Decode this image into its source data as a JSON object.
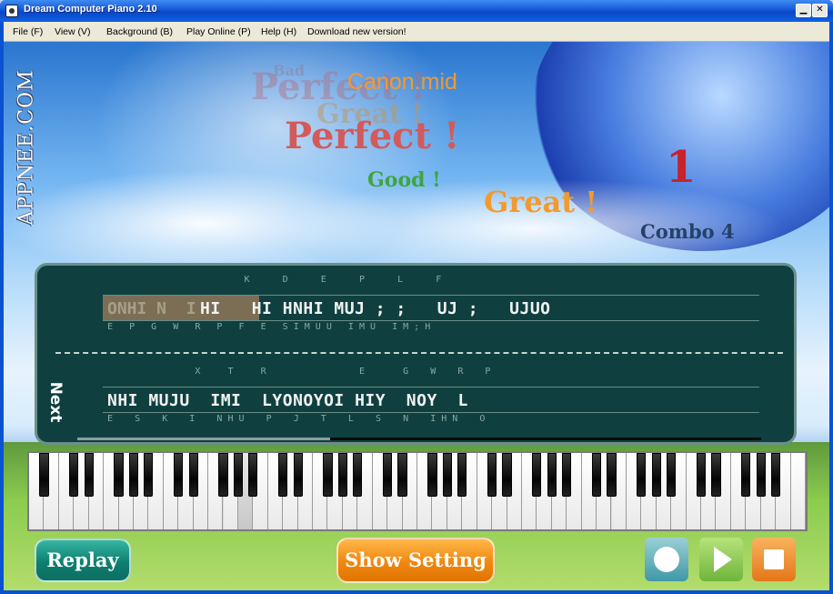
{
  "window": {
    "title": "Dream Computer Piano 2.10",
    "min_glyph": "▁",
    "close_glyph": "✕"
  },
  "menu": [
    {
      "label": "File (F)"
    },
    {
      "label": "View (V)"
    },
    {
      "label": "Background (B)"
    },
    {
      "label": "Play Online (P)"
    },
    {
      "label": "Help (H)"
    },
    {
      "label": "Download new version!"
    }
  ],
  "watermark": "APPNEE.COM",
  "effects": {
    "bad": "Bad",
    "perfect_ghost": "Perfect !",
    "song": "Canon.mid",
    "great_ghost": "Great !",
    "perfect": "Perfect !",
    "good": "Good !",
    "great": "Great !",
    "count": "1",
    "combo": "Combo 4"
  },
  "score": {
    "next_label": "Next",
    "row1": {
      "top": "                         K      D      E      P      L      F",
      "played": "ONHI N  I",
      "main": "         HI   HI HNHI MUJ ; ;   UJ ;   UJUO",
      "bottom": "E   P   G   W   R   P   F   E   S I M U U   I M U   I M ; H"
    },
    "row2": {
      "top": "                X     T     R                 E       G    W    R    P",
      "main": "NHI MUJU  IMI  LYONOYOI HIY  NOY  L",
      "bottom": "E    S    K    I    N H U    P    J    T    L    S    N    I H N    O"
    },
    "progress": 0.37
  },
  "piano": {
    "white_keys": 52,
    "active_key": 14
  },
  "buttons": {
    "replay": "Replay",
    "show_setting": "Show Setting"
  },
  "icons": {
    "record": "record-icon",
    "play": "play-icon",
    "stop": "stop-icon"
  },
  "colors": {
    "panel": "#0f403f",
    "replay": "#0f7f70",
    "show_setting": "#f0870f",
    "perfect": "#d35a5a",
    "good": "#3ea542",
    "great": "#f29a2e",
    "count": "#c8222a"
  }
}
